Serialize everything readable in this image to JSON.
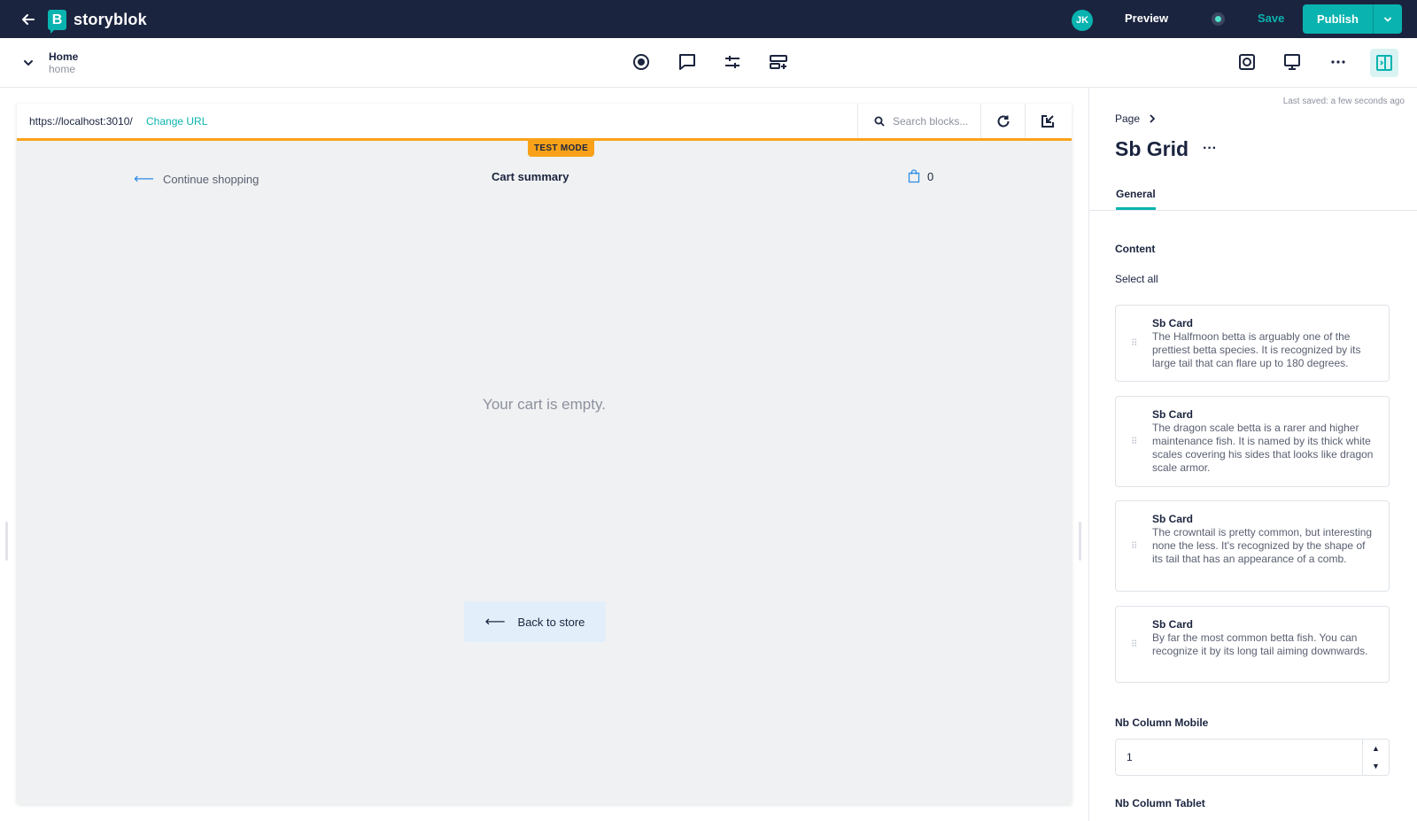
{
  "app": {
    "brand": "storyblok",
    "brand_initial": "B",
    "accent": "#09b3af",
    "nav_bg": "#1b243f",
    "testmode_color": "#f9a219"
  },
  "topbar": {
    "avatar_initials": "JK",
    "preview_label": "Preview",
    "save_label": "Save",
    "publish_label": "Publish"
  },
  "story": {
    "title": "Home",
    "slug": "home"
  },
  "toolbar_icons": [
    "target-icon",
    "comment-icon",
    "sliders-icon",
    "block-add-icon",
    "screenshot-icon",
    "desktop-icon",
    "more-icon",
    "panel-toggle-icon"
  ],
  "preview": {
    "url": "https://localhost:3010/",
    "change_url_label": "Change URL",
    "search_placeholder": "Search blocks...",
    "test_mode_label": "TEST MODE",
    "continue_shopping": "Continue shopping",
    "cart_title": "Cart summary",
    "cart_count": "0",
    "empty_message": "Your cart is empty.",
    "back_to_store": "Back to store"
  },
  "panel": {
    "last_saved": "Last saved: a few seconds ago",
    "breadcrumb": "Page",
    "title": "Sb Grid",
    "tab_general": "General",
    "content_label": "Content",
    "select_all": "Select all",
    "cards": [
      {
        "title": "Sb Card",
        "desc": "The Halfmoon betta is arguably one of the prettiest betta species. It is recognized by its large tail that can flare up to 180 degrees."
      },
      {
        "title": "Sb Card",
        "desc": "The dragon scale betta is a rarer and higher maintenance fish. It is named by its thick white scales covering his sides that looks like dragon scale armor."
      },
      {
        "title": "Sb Card",
        "desc": "The crowntail is pretty common, but interesting none the less. It's recognized by the shape of its tail that has an appearance of a comb."
      },
      {
        "title": "Sb Card",
        "desc": "By far the most common betta fish. You can recognize it by its long tail aiming downwards."
      }
    ],
    "nb_column_mobile_label": "Nb Column Mobile",
    "nb_column_mobile_value": "1",
    "nb_column_tablet_label": "Nb Column Tablet"
  }
}
